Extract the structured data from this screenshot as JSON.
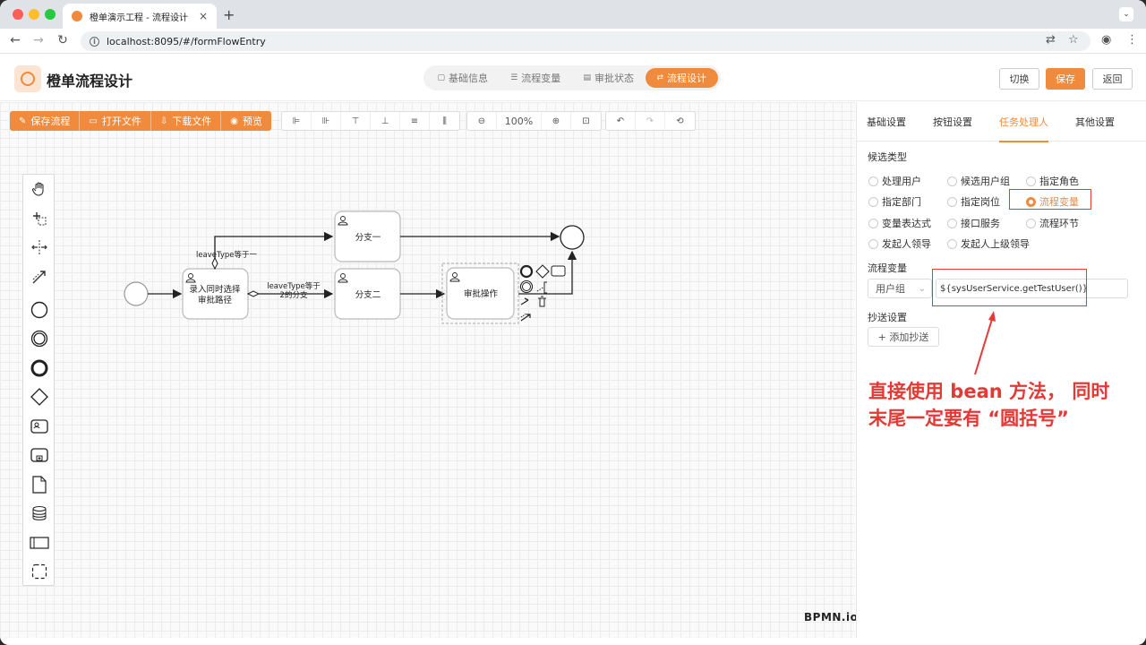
{
  "browser": {
    "tab_title": "橙单演示工程 - 流程设计",
    "tab_close": "×",
    "new_tab": "+",
    "tab_menu": "⌄",
    "url": "localhost:8095/#/formFlowEntry",
    "back": "←",
    "forward": "→",
    "reload": "↻",
    "info": "i",
    "translate": "⇄",
    "bookmark": "☆",
    "profile": "◉",
    "menu": "⋮",
    "traffic_colors": [
      "#ff5f57",
      "#febc2e",
      "#28c840"
    ]
  },
  "app": {
    "title": "橙单流程设计",
    "steps": [
      {
        "icon": "▢",
        "label": "基础信息"
      },
      {
        "icon": "☰",
        "label": "流程变量"
      },
      {
        "icon": "▤",
        "label": "审批状态"
      },
      {
        "icon": "⇄",
        "label": "流程设计",
        "active": true
      }
    ],
    "buttons": {
      "switch": "切换",
      "save": "保存",
      "back": "返回"
    },
    "accent": "#f08a3c"
  },
  "toolbar": {
    "actions": [
      {
        "icon": "✎",
        "label": "保存流程"
      },
      {
        "icon": "▭",
        "label": "打开文件"
      },
      {
        "icon": "⇩",
        "label": "下载文件"
      },
      {
        "icon": "◉",
        "label": "预览"
      }
    ],
    "align": [
      "⊫",
      "⊪",
      "⊤",
      "⊥",
      "≡",
      "⫼"
    ],
    "zoom_out": "⊖",
    "zoom": "100%",
    "zoom_in": "⊕",
    "fit": "⊡",
    "undo": "↶",
    "redo": "↷",
    "reset": "⟲"
  },
  "diagram": {
    "tasks": {
      "entry": "录入同时选择审批路径",
      "branch1": "分支一",
      "branch2": "分支二",
      "approve": "审批操作"
    },
    "flow_labels": {
      "top": "leaveType等于一",
      "mid_line1": "leaveType等于",
      "mid_line2": "2的分支"
    },
    "watermark": "BPMN.io"
  },
  "panel": {
    "tabs": [
      "基础设置",
      "按钮设置",
      "任务处理人",
      "其他设置"
    ],
    "active_tab": 2,
    "candidate_type_label": "候选类型",
    "radios": [
      "处理用户",
      "候选用户组",
      "指定角色",
      "指定部门",
      "指定岗位",
      "流程变量",
      "变量表达式",
      "接口服务",
      "流程环节",
      "发起人领导",
      "发起人上级领导"
    ],
    "checked_radio": "流程变量",
    "var_label": "流程变量",
    "var_type": "用户组",
    "var_type_arrow": "⌄",
    "var_value": "${sysUserService.getTestUser()}",
    "cc_label": "抄送设置",
    "add_cc": "+ 添加抄送"
  },
  "annotation": {
    "line1": "直接使用 bean 方法，  同时",
    "line2": "末尾一定要有 “圆括号”",
    "color": "#e53935"
  }
}
